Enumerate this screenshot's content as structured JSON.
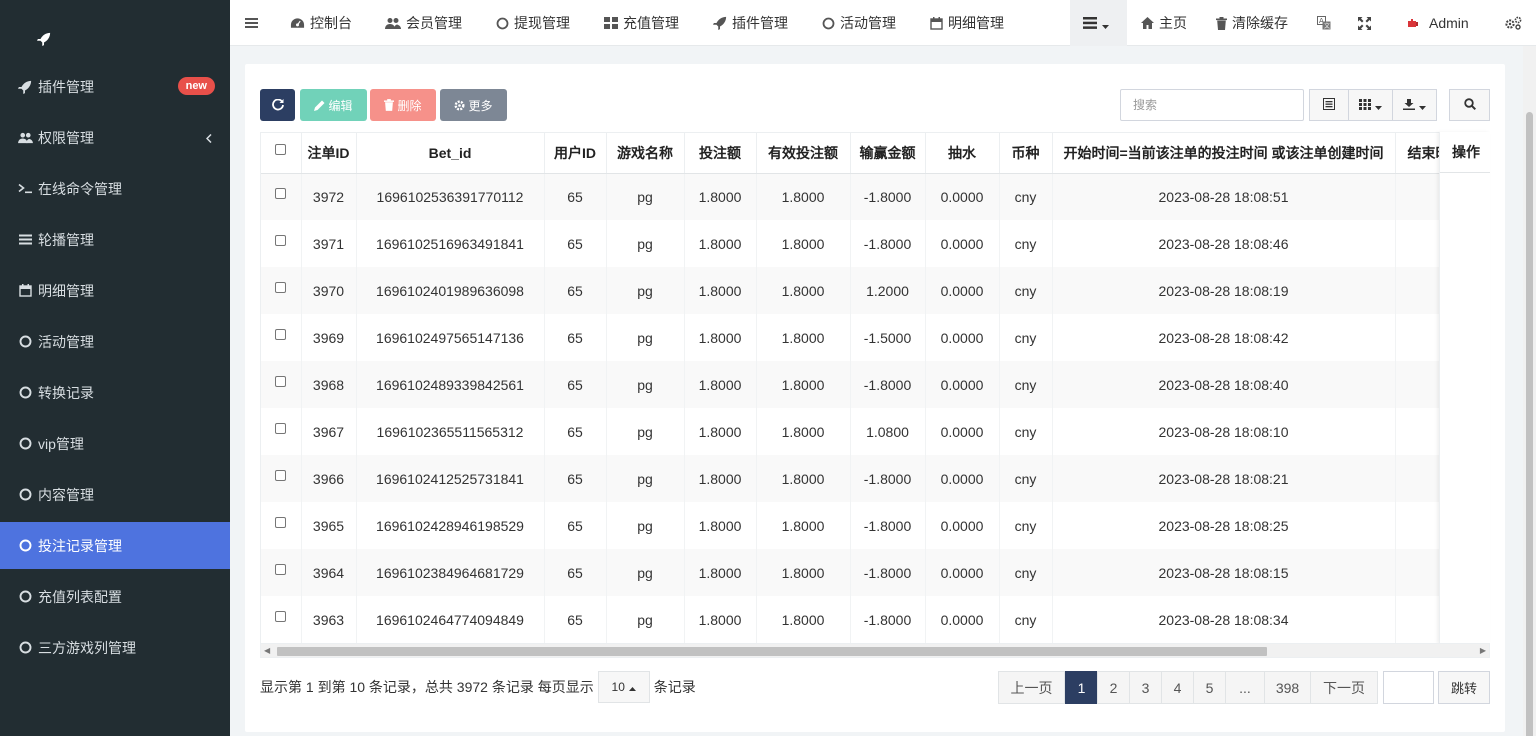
{
  "sidebar": {
    "items": [
      {
        "label": "插件管理",
        "badge": "new",
        "icon": "rocket-icon"
      },
      {
        "label": "权限管理",
        "icon": "users-icon"
      },
      {
        "label": "在线命令管理",
        "icon": "terminal-icon"
      },
      {
        "label": "轮播管理",
        "icon": "list-icon"
      },
      {
        "label": "明细管理",
        "icon": "calendar-icon"
      },
      {
        "label": "活动管理",
        "icon": "circle-icon"
      },
      {
        "label": "转换记录",
        "icon": "circle-icon"
      },
      {
        "label": "vip管理",
        "icon": "circle-icon"
      },
      {
        "label": "内容管理",
        "icon": "circle-icon"
      },
      {
        "label": "投注记录管理",
        "icon": "circle-icon",
        "active": true
      },
      {
        "label": "充值列表配置",
        "icon": "circle-icon"
      },
      {
        "label": "三方游戏列管理",
        "icon": "circle-icon"
      }
    ]
  },
  "topnav": {
    "items": [
      "控制台",
      "会员管理",
      "提现管理",
      "充值管理",
      "插件管理",
      "活动管理",
      "明细管理"
    ],
    "home": "主页",
    "clear_cache": "清除缓存",
    "admin": "Admin"
  },
  "toolbar": {
    "edit": "编辑",
    "delete": "删除",
    "more": "更多",
    "search_placeholder": "搜索"
  },
  "table": {
    "columns": [
      "注单ID",
      "Bet_id",
      "用户ID",
      "游戏名称",
      "投注额",
      "有效投注额",
      "输赢金额",
      "抽水",
      "币种",
      "开始时间=当前该注单的投注时间 或该注单创建时间",
      "结束时"
    ],
    "ops_header": "操作",
    "rows": [
      [
        "3972",
        "1696102536391770112",
        "65",
        "pg",
        "1.8000",
        "1.8000",
        "-1.8000",
        "0.0000",
        "cny",
        "2023-08-28 18:08:51",
        ""
      ],
      [
        "3971",
        "1696102516963491841",
        "65",
        "pg",
        "1.8000",
        "1.8000",
        "-1.8000",
        "0.0000",
        "cny",
        "2023-08-28 18:08:46",
        ""
      ],
      [
        "3970",
        "1696102401989636098",
        "65",
        "pg",
        "1.8000",
        "1.8000",
        "1.2000",
        "0.0000",
        "cny",
        "2023-08-28 18:08:19",
        ""
      ],
      [
        "3969",
        "1696102497565147136",
        "65",
        "pg",
        "1.8000",
        "1.8000",
        "-1.5000",
        "0.0000",
        "cny",
        "2023-08-28 18:08:42",
        ""
      ],
      [
        "3968",
        "1696102489339842561",
        "65",
        "pg",
        "1.8000",
        "1.8000",
        "-1.8000",
        "0.0000",
        "cny",
        "2023-08-28 18:08:40",
        ""
      ],
      [
        "3967",
        "1696102365511565312",
        "65",
        "pg",
        "1.8000",
        "1.8000",
        "1.0800",
        "0.0000",
        "cny",
        "2023-08-28 18:08:10",
        ""
      ],
      [
        "3966",
        "1696102412525731841",
        "65",
        "pg",
        "1.8000",
        "1.8000",
        "-1.8000",
        "0.0000",
        "cny",
        "2023-08-28 18:08:21",
        ""
      ],
      [
        "3965",
        "1696102428946198529",
        "65",
        "pg",
        "1.8000",
        "1.8000",
        "-1.8000",
        "0.0000",
        "cny",
        "2023-08-28 18:08:25",
        ""
      ],
      [
        "3964",
        "1696102384964681729",
        "65",
        "pg",
        "1.8000",
        "1.8000",
        "-1.8000",
        "0.0000",
        "cny",
        "2023-08-28 18:08:15",
        ""
      ],
      [
        "3963",
        "1696102464774094849",
        "65",
        "pg",
        "1.8000",
        "1.8000",
        "-1.8000",
        "0.0000",
        "cny",
        "2023-08-28 18:08:34",
        ""
      ]
    ]
  },
  "pagination": {
    "info_prefix": "显示第 1 到第 10 条记录，总共 3972 条记录 每页显示",
    "page_size": "10",
    "info_suffix": "条记录",
    "prev": "上一页",
    "pages": [
      "1",
      "2",
      "3",
      "4",
      "5",
      "...",
      "398"
    ],
    "next": "下一页",
    "jump": "跳转"
  },
  "colors": {
    "sidebar_bg": "#222d32",
    "active_item": "#4e73df",
    "primary": "#2c3e62",
    "edit": "#71d2b9",
    "delete": "#f6918a",
    "more": "#7d8795",
    "badge": "#e8504a"
  }
}
